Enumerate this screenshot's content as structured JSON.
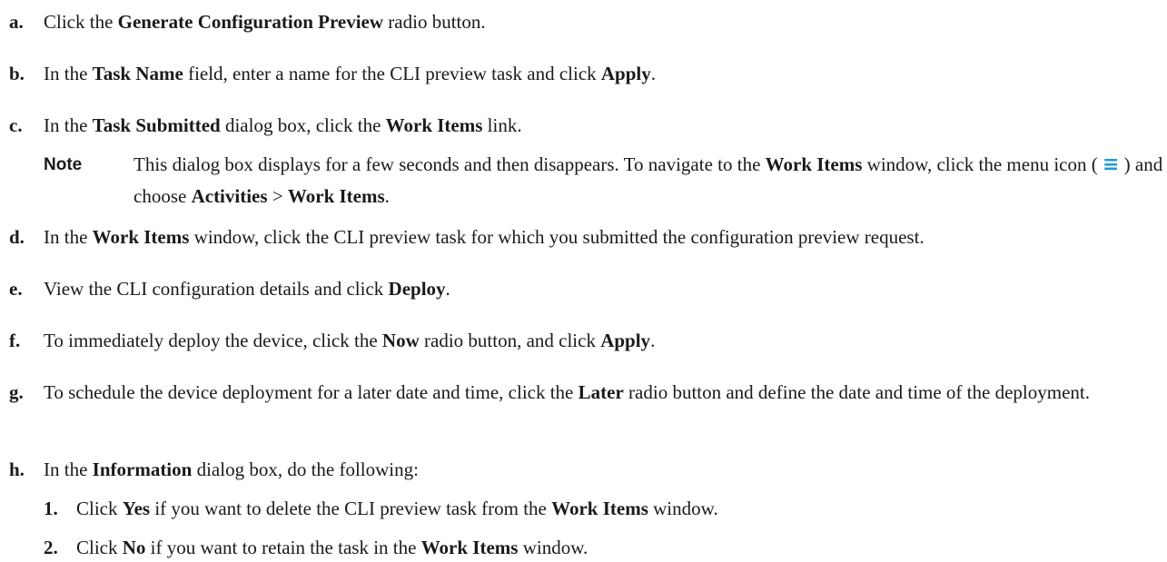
{
  "steps": {
    "a": {
      "marker": "a.",
      "t1": "Click the ",
      "b1": "Generate Configuration Preview",
      "t2": " radio button."
    },
    "b": {
      "marker": "b.",
      "t1": "In the ",
      "b1": "Task Name",
      "t2": " field, enter a name for the CLI preview task and click ",
      "b2": "Apply",
      "t3": "."
    },
    "c": {
      "marker": "c.",
      "t1": "In the ",
      "b1": "Task Submitted",
      "t2": " dialog box, click the ",
      "b2": "Work Items",
      "t3": " link."
    },
    "d": {
      "marker": "d.",
      "t1": "In the ",
      "b1": "Work Items",
      "t2": " window, click the CLI preview task for which you submitted the configuration preview request."
    },
    "e": {
      "marker": "e.",
      "t1": "View the CLI configuration details and click ",
      "b1": "Deploy",
      "t2": "."
    },
    "f": {
      "marker": "f.",
      "t1": "To immediately deploy the device, click the ",
      "b1": "Now",
      "t2": " radio button, and click ",
      "b2": "Apply",
      "t3": "."
    },
    "g": {
      "marker": "g.",
      "t1": "To schedule the device deployment for a later date and time, click the ",
      "b1": "Later",
      "t2": " radio button and define the date and time of the deployment."
    },
    "h": {
      "marker": "h.",
      "t1": "In the ",
      "b1": "Information",
      "t2": " dialog box, do the following:"
    }
  },
  "note": {
    "label": "Note",
    "t1": "This dialog box displays for a few seconds and then disappears. To navigate to the ",
    "b1": "Work Items",
    "t2": " window, click the menu icon ( ",
    "icon": "≡",
    "t3": " ) and choose ",
    "b2": "Activities",
    "t4": " > ",
    "b3": "Work Items",
    "t5": "."
  },
  "substeps": [
    {
      "marker": "1.",
      "t1": "Click ",
      "b1": "Yes",
      "t2": " if you want to delete the CLI preview task from the ",
      "b2": "Work Items",
      "t3": " window."
    },
    {
      "marker": "2.",
      "t1": "Click ",
      "b1": "No",
      "t2": " if you want to retain the task in the ",
      "b2": "Work Items",
      "t3": " window."
    }
  ],
  "icons": {
    "menu": "hamburger-menu-icon"
  },
  "colors": {
    "icon_accent": "#1e9ad6",
    "text": "#1a1a1a"
  }
}
